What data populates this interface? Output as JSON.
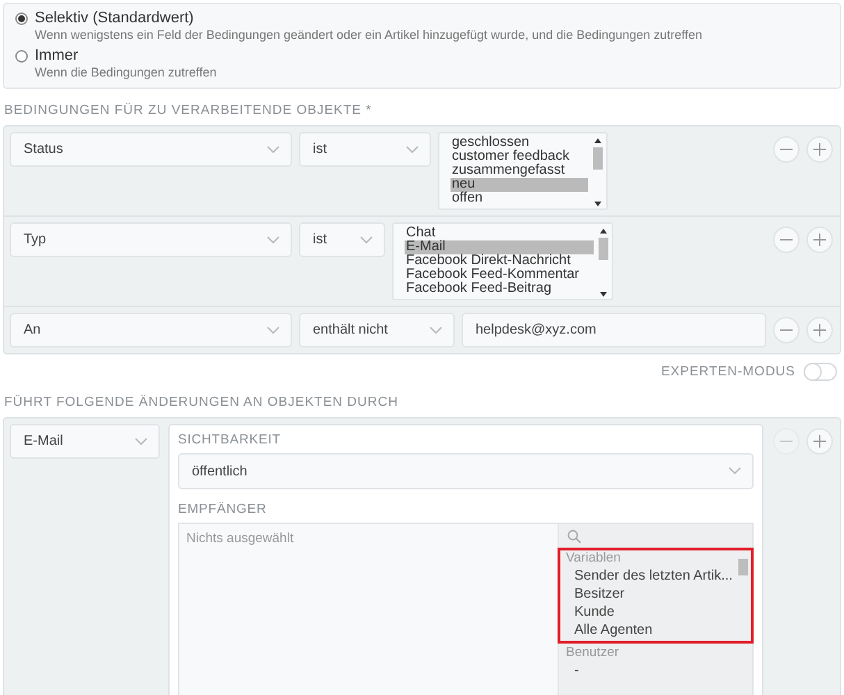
{
  "trigger_options": [
    {
      "label": "Selektiv (Standardwert)",
      "description": "Wenn wenigstens ein Feld der Bedingungen geändert oder ein Artikel hinzugefügt wurde, und die Bedingungen zutreffen",
      "selected": true
    },
    {
      "label": "Immer",
      "description": "Wenn die Bedingungen zutreffen",
      "selected": false
    }
  ],
  "conditions": {
    "heading": "BEDINGUNGEN FÜR ZU VERARBEITENDE OBJEKTE *",
    "rows": [
      {
        "kind": "list",
        "attribute": "Status",
        "operator": "ist",
        "remove_disabled": false,
        "options": [
          {
            "label": "geschlossen",
            "selected": false
          },
          {
            "label": "customer feedback",
            "selected": false
          },
          {
            "label": "zusammengefasst",
            "selected": false
          },
          {
            "label": "neu",
            "selected": true
          },
          {
            "label": "offen",
            "selected": false
          }
        ]
      },
      {
        "kind": "list",
        "attribute": "Typ",
        "operator": "ist",
        "remove_disabled": false,
        "options": [
          {
            "label": "Chat",
            "selected": false
          },
          {
            "label": "E-Mail",
            "selected": true
          },
          {
            "label": "Facebook Direkt-Nachricht",
            "selected": false
          },
          {
            "label": "Facebook Feed-Kommentar",
            "selected": false
          },
          {
            "label": "Facebook Feed-Beitrag",
            "selected": false
          }
        ]
      },
      {
        "kind": "text",
        "attribute": "An",
        "operator": "enthält nicht",
        "value": "helpdesk@xyz.com",
        "remove_disabled": false
      }
    ]
  },
  "expert_mode": {
    "label": "EXPERTEN-MODUS",
    "on": false
  },
  "actions": {
    "heading": "FÜHRT FOLGENDE ÄNDERUNGEN AN OBJEKTEN DURCH",
    "type": "E-Mail",
    "remove_disabled": true,
    "visibility": {
      "label": "SICHTBARKEIT",
      "value": "öffentlich"
    },
    "recipients": {
      "label": "EMPFÄNGER",
      "placeholder": "Nichts ausgewählt",
      "groups": [
        {
          "label": "Variablen",
          "highlighted": true,
          "items": [
            "Sender des letzten Artik...",
            "Besitzer",
            "Kunde",
            "Alle Agenten"
          ]
        },
        {
          "label": "Benutzer",
          "highlighted": false,
          "items": [
            "-"
          ]
        }
      ]
    }
  }
}
